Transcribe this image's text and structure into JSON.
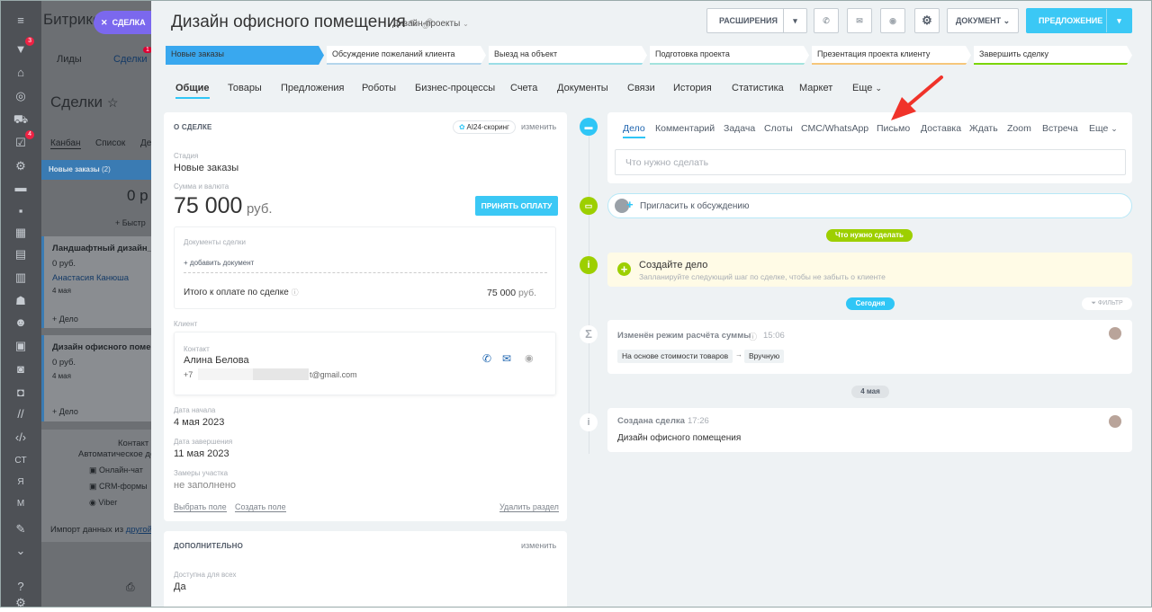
{
  "background": {
    "app_name": "Битрикс",
    "close_label": "СДЕЛКА",
    "tab_leads": "Лиды",
    "tab_deals": "Сделки",
    "tab_deals_badge": "1",
    "page_title": "Сделки",
    "view_kanban": "Канбан",
    "view_list": "Список",
    "view_more": "Де",
    "column_name": "Новые заказы",
    "column_count": "(2)",
    "column_sum": "0 р",
    "quick_add": "+ Быстр",
    "cards": [
      {
        "title": "Ландшафтный дизайн_бо...",
        "sum": "0 руб.",
        "contact": "Анастасия Канюша",
        "date": "4 мая",
        "add": "+ Дело"
      },
      {
        "title": "Дизайн офисного помещ...",
        "sum": "0 руб.",
        "contact": "",
        "date": "4 мая",
        "add": "+ Дело"
      }
    ],
    "contact_title": "Контакт",
    "contact_sub": "Автоматическое до",
    "channels": [
      "Онлайн-чат",
      "CRM-формы",
      "Viber"
    ],
    "import_text": "Импорт данных из",
    "import_link": "другой",
    "rail_badges": [
      "3",
      "4"
    ],
    "rail_texts": [
      "CT",
      "Я",
      "M"
    ]
  },
  "deal": {
    "title": "Дизайн офисного помещения",
    "category": "Дизайн-проекты",
    "toolbar": {
      "extensions": "РАСШИРЕНИЯ",
      "document": "ДОКУМЕНТ",
      "offer": "ПРЕДЛОЖЕНИЕ"
    },
    "stages": [
      {
        "label": "Новые заказы",
        "color": "#39a8ef"
      },
      {
        "label": "Обсуждение пожеланий клиента",
        "color": "#b4d6ec"
      },
      {
        "label": "Выезд на объект",
        "color": "#9bdde6"
      },
      {
        "label": "Подготовка проекта",
        "color": "#a3e3dd"
      },
      {
        "label": "Презентация проекта клиенту",
        "color": "#f6c77b"
      },
      {
        "label": "Завершить сделку",
        "color": "#7bd500"
      }
    ],
    "tabs": [
      "Общие",
      "Товары",
      "Предложения",
      "Роботы",
      "Бизнес-процессы",
      "Счета",
      "Документы",
      "Связи",
      "История",
      "Статистика",
      "Маркет",
      "Еще"
    ]
  },
  "about": {
    "header": "О СДЕЛКЕ",
    "scoring": "AI24-скоринг",
    "edit": "изменить",
    "stage_label": "Стадия",
    "stage_value": "Новые заказы",
    "sum_label": "Сумма и валюта",
    "amount": "75 000",
    "currency": "руб.",
    "accept_payment": "ПРИНЯТЬ ОПЛАТУ",
    "docs_label": "Документы сделки",
    "add_doc": "+ добавить документ",
    "total_label": "Итого к оплате по сделке",
    "total_value": "75 000",
    "total_currency": "руб.",
    "client_label": "Клиент",
    "contact_label": "Контакт",
    "contact_name": "Алина Белова",
    "contact_phone": "+7",
    "contact_email": "t@gmail.com",
    "start_label": "Дата начала",
    "start_value": "4 мая 2023",
    "end_label": "Дата завершения",
    "end_value": "11 мая 2023",
    "measure_label": "Замеры участка",
    "measure_value": "не заполнено",
    "select_field": "Выбрать поле",
    "create_field": "Создать поле",
    "delete_section": "Удалить раздел"
  },
  "extra": {
    "header": "ДОПОЛНИТЕЛЬНО",
    "edit": "изменить",
    "available_label": "Доступна для всех",
    "available_value": "Да"
  },
  "timeline": {
    "activity_tabs": [
      "Дело",
      "Комментарий",
      "Задача",
      "Слоты",
      "СМС/WhatsApp",
      "Письмо",
      "Доставка",
      "Ждать",
      "Zoom",
      "Встреча",
      "Еще"
    ],
    "todo_placeholder": "Что нужно сделать",
    "invite": "Пригласить к обсуждению",
    "todo_chip": "Что нужно сделать",
    "create_task_title": "Создайте дело",
    "create_task_text": "Запланируйте следующий шаг по сделке, чтобы не забыть о клиенте",
    "today_chip": "Сегодня",
    "filter": "ФИЛЬТР",
    "event1_title": "Изменён режим расчёта суммы",
    "event1_time": "15:06",
    "event1_from": "На основе стоимости товаров",
    "event1_to": "Вручную",
    "date_chip": "4 мая",
    "event2_title": "Создана сделка",
    "event2_time": "17:26",
    "event2_text": "Дизайн офисного помещения"
  },
  "colors": {
    "accent": "#2fc6f6",
    "green": "#9dcf00",
    "annotation_arrow": "#f0332a"
  }
}
